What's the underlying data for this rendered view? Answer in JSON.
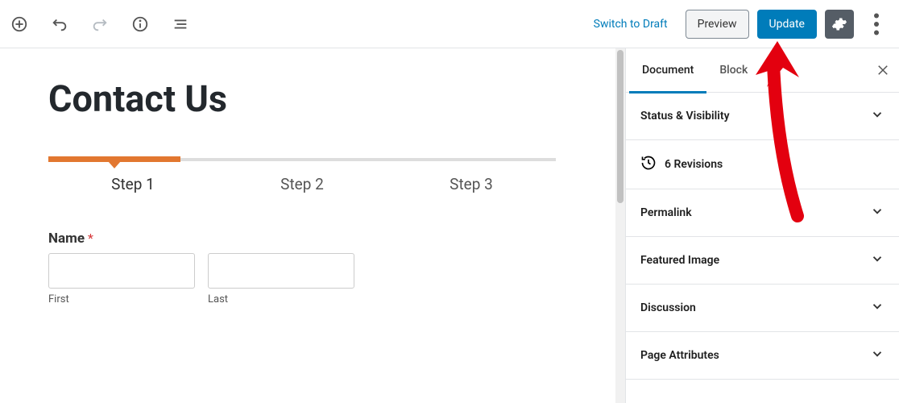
{
  "toolbar": {
    "switch": "Switch to Draft",
    "preview": "Preview",
    "update": "Update"
  },
  "sidebar": {
    "tabs": {
      "document": "Document",
      "block": "Block"
    },
    "panels": {
      "status": "Status & Visibility",
      "revisions_count": "6 Revisions",
      "permalink": "Permalink",
      "featured": "Featured Image",
      "discussion": "Discussion",
      "attributes": "Page Attributes"
    }
  },
  "page": {
    "title": "Contact Us",
    "steps": [
      "Step 1",
      "Step 2",
      "Step 3"
    ],
    "form": {
      "name_label": "Name",
      "first_sub": "First",
      "last_sub": "Last"
    }
  }
}
